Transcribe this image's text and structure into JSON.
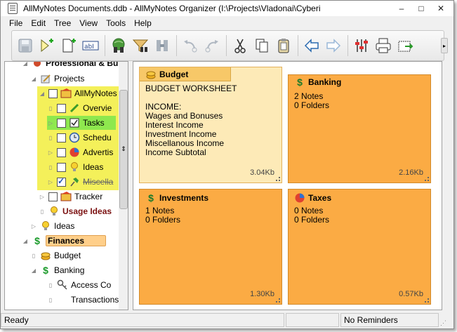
{
  "window": {
    "title": "AllMyNotes Documents.ddb - AllMyNotes Organizer (I:\\Projects\\Vladonai\\Cyberi",
    "controls": {
      "minimize": "–",
      "maximize": "□",
      "close": "✕"
    }
  },
  "menu": [
    "File",
    "Edit",
    "Tree",
    "View",
    "Tools",
    "Help"
  ],
  "toolbar": {
    "buttons": [
      {
        "name": "save-icon"
      },
      {
        "name": "add-note-icon"
      },
      {
        "name": "add-subnote-icon"
      },
      {
        "name": "rename-icon"
      },
      {
        "name": "search-icon"
      },
      {
        "name": "filter-icon"
      },
      {
        "name": "find-icon"
      },
      {
        "name": "undo-icon"
      },
      {
        "name": "redo-icon"
      },
      {
        "name": "cut-icon"
      },
      {
        "name": "copy-icon"
      },
      {
        "name": "paste-icon"
      },
      {
        "name": "back-icon"
      },
      {
        "name": "forward-icon"
      },
      {
        "name": "settings-icon"
      },
      {
        "name": "print-icon"
      },
      {
        "name": "export-icon"
      }
    ]
  },
  "tree": {
    "items": [
      {
        "label": "Professional & Bu",
        "level": 0
      },
      {
        "label": "Projects",
        "level": 1
      },
      {
        "label": "AllMyNotes",
        "level": 2
      },
      {
        "label": "Overvie",
        "level": 3
      },
      {
        "label": "Tasks",
        "level": 3
      },
      {
        "label": "Schedu",
        "level": 3
      },
      {
        "label": "Advertis",
        "level": 3
      },
      {
        "label": "Ideas",
        "level": 3
      },
      {
        "label": "Miscella",
        "level": 3
      },
      {
        "label": "Tracker",
        "level": 2
      },
      {
        "label": "Usage Ideas",
        "level": 1
      },
      {
        "label": "Ideas",
        "level": 1
      },
      {
        "label": "Finances",
        "level": 0
      },
      {
        "label": "Budget",
        "level": 1
      },
      {
        "label": "Banking",
        "level": 1
      },
      {
        "label": "Access Co",
        "level": 2
      },
      {
        "label": "Transactions",
        "level": 2
      }
    ]
  },
  "cards": [
    {
      "title": "Budget",
      "body": "BUDGET WORKSHEET\n\nINCOME:\nWages and Bonuses\nInterest Income\nInvestment Income\nMiscellanous Income\nIncome Subtotal",
      "size": "3.04Kb"
    },
    {
      "title": "Banking",
      "body": "2 Notes\n0 Folders",
      "size": "2.16Kb"
    },
    {
      "title": "Investments",
      "body": "1 Notes\n0 Folders",
      "size": "1.30Kb"
    },
    {
      "title": "Taxes",
      "body": "0 Notes\n0 Folders",
      "size": "0.57Kb"
    }
  ],
  "status": {
    "left": "Ready",
    "right": "No Reminders"
  },
  "colors": {
    "card_orange": "#fbab44",
    "card_selected": "#fdeab7",
    "highlight_yellow": "#f4f05a",
    "highlight_green": "#8ee84e"
  }
}
